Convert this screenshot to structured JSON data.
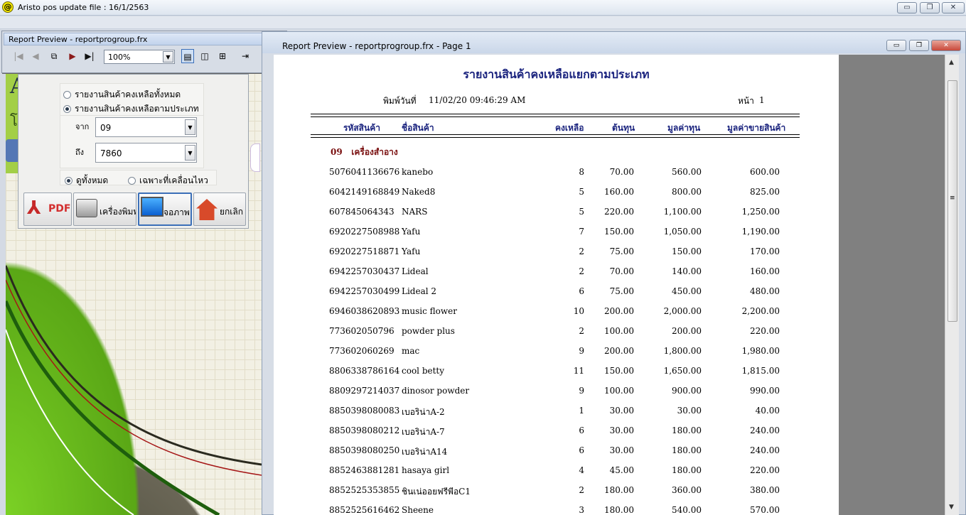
{
  "app": {
    "icon_glyph": "@",
    "title": "Aristo pos  update file : 16/1/2563",
    "controls": {
      "minimize": "▭",
      "restore": "❐",
      "close": "✕"
    }
  },
  "background_window": {
    "glyph_top": "A",
    "glyph_bottom": "โ"
  },
  "report_dialog": {
    "report_options": [
      "รายงานสินค้าคงเหลือทั้งหมด",
      "รายงานสินค้าคงเหลือตามประเภท"
    ],
    "selected_report_index": 1,
    "from_label": "จาก",
    "from_value": "09",
    "to_label": "ถึง",
    "to_value": "7860",
    "view_options": [
      "ดูทั้งหมด",
      "เฉพาะที่เคลื่อนไหว"
    ],
    "selected_view_index": 0,
    "buttons": {
      "pdf": "PDF",
      "printer": "เครื่องพิมพ์",
      "screen": "จอภาพ",
      "cancel": "ยกเลิก"
    }
  },
  "preview_toolbar": {
    "title": "Report Preview - reportprogroup.frx",
    "zoom": "100%",
    "icons": [
      "first-page-icon",
      "prev-page-icon",
      "copy-icon",
      "next-page-icon",
      "last-page-icon",
      "one-page-icon",
      "two-page-icon",
      "four-page-icon",
      "exit-preview-icon",
      "print-icon"
    ]
  },
  "preview_window": {
    "title": "Report Preview - reportprogroup.frx - Page 1"
  },
  "report": {
    "title": "รายงานสินค้าคงเหลือแยกตามประเภท",
    "print_date_label": "พิมพ์วันที่",
    "print_date": "11/02/20 09:46:29 AM",
    "page_label": "หน้า",
    "page_number": "1",
    "columns": {
      "code": "รหัสสินค้า",
      "name": "ชื่อสินค้า",
      "qty": "คงเหลือ",
      "cost": "ต้นทุน",
      "cost_value": "มูลค่าทุน",
      "sale_value": "มูลค่าขายสินค้า"
    },
    "group_code": "09",
    "group_name": "เครื่องสำอาง",
    "rows": [
      [
        "5076041136676",
        "kanebo",
        "8",
        "70.00",
        "560.00",
        "600.00"
      ],
      [
        "6042149168849",
        "Naked8",
        "5",
        "160.00",
        "800.00",
        "825.00"
      ],
      [
        "607845064343",
        "NARS",
        "5",
        "220.00",
        "1,100.00",
        "1,250.00"
      ],
      [
        "6920227508988",
        "Yafu",
        "7",
        "150.00",
        "1,050.00",
        "1,190.00"
      ],
      [
        "6920227518871",
        "Yafu",
        "2",
        "75.00",
        "150.00",
        "170.00"
      ],
      [
        "6942257030437",
        "Lideal",
        "2",
        "70.00",
        "140.00",
        "160.00"
      ],
      [
        "6942257030499",
        "Lideal 2",
        "6",
        "75.00",
        "450.00",
        "480.00"
      ],
      [
        "6946038620893",
        "music flower",
        "10",
        "200.00",
        "2,000.00",
        "2,200.00"
      ],
      [
        "773602050796",
        "powder plus",
        "2",
        "100.00",
        "200.00",
        "220.00"
      ],
      [
        "773602060269",
        "mac",
        "9",
        "200.00",
        "1,800.00",
        "1,980.00"
      ],
      [
        "8806338786164",
        "cool betty",
        "11",
        "150.00",
        "1,650.00",
        "1,815.00"
      ],
      [
        "8809297214037",
        "dinosor powder",
        "9",
        "100.00",
        "900.00",
        "990.00"
      ],
      [
        "8850398080083",
        "เบอริน่าA-2",
        "1",
        "30.00",
        "30.00",
        "40.00"
      ],
      [
        "8850398080212",
        "เบอริน่าA-7",
        "6",
        "30.00",
        "180.00",
        "240.00"
      ],
      [
        "8850398080250",
        "เบอริน่าA14",
        "6",
        "30.00",
        "180.00",
        "240.00"
      ],
      [
        "8852463881281",
        "hasaya girl",
        "4",
        "45.00",
        "180.00",
        "220.00"
      ],
      [
        "8852525353855",
        "ชินเน่ออยฟรีพีอC1",
        "2",
        "180.00",
        "360.00",
        "380.00"
      ],
      [
        "8852525616462",
        "Sheene",
        "3",
        "180.00",
        "540.00",
        "570.00"
      ]
    ]
  },
  "scrollbar": {
    "up": "▲",
    "grip": "≡",
    "down": "▼"
  }
}
